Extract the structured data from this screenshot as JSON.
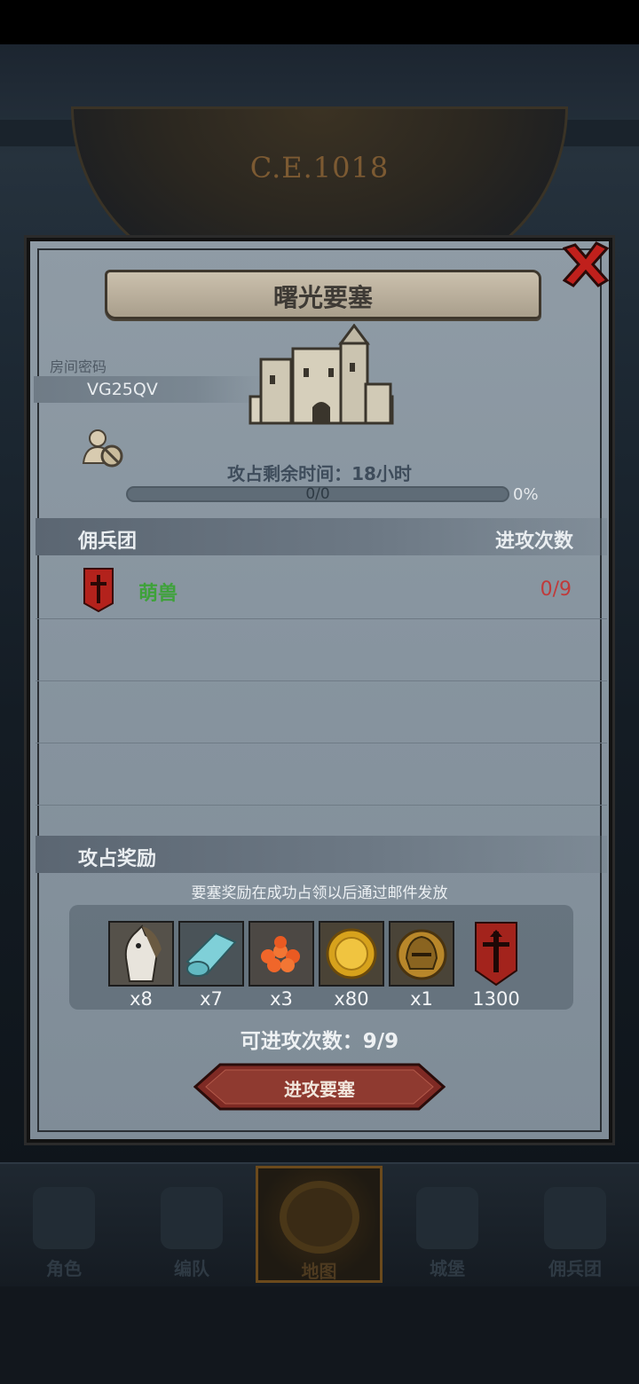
{
  "header": {
    "era_label": "C.E.1018"
  },
  "dialog": {
    "title": "曙光要塞",
    "room_password_label": "房间密码",
    "room_password_value": "VG25QV",
    "timer_text": "攻占剩余时间：18小时",
    "progress": {
      "count_text": "0/0",
      "percent_text": "0%",
      "fraction": 0
    },
    "mercenary_section": {
      "title": "佣兵团",
      "attacks_header": "进攻次数",
      "rows": [
        {
          "name": "萌兽",
          "attacks": "0/9"
        }
      ]
    },
    "reward_section": {
      "title": "攻占奖励",
      "note": "要塞奖励在成功占领以后通过邮件发放",
      "items": [
        {
          "icon": "horse-icon",
          "qty": "x8"
        },
        {
          "icon": "cloth-roll-icon",
          "qty": "x7"
        },
        {
          "icon": "orange-gems-icon",
          "qty": "x3"
        },
        {
          "icon": "gold-coin-icon",
          "qty": "x80"
        },
        {
          "icon": "knight-helmet-icon",
          "qty": "x1"
        },
        {
          "icon": "banner-emblem-icon",
          "qty": "1300"
        }
      ]
    },
    "attempts_text": "可进攻次数：9/9",
    "attack_button": "进攻要塞"
  },
  "nav": {
    "items": [
      {
        "label": "角色",
        "icon": "knight-icon"
      },
      {
        "label": "编队",
        "icon": "formation-icon"
      },
      {
        "label": "地图",
        "icon": "compass-map-icon"
      },
      {
        "label": "城堡",
        "icon": "castle-icon"
      },
      {
        "label": "佣兵团",
        "icon": "mercenary-icon"
      }
    ],
    "active_index": 2
  },
  "colors": {
    "accent_green": "#3ea23a",
    "accent_red": "#c03a3a",
    "button_red": "#7e2a24"
  }
}
